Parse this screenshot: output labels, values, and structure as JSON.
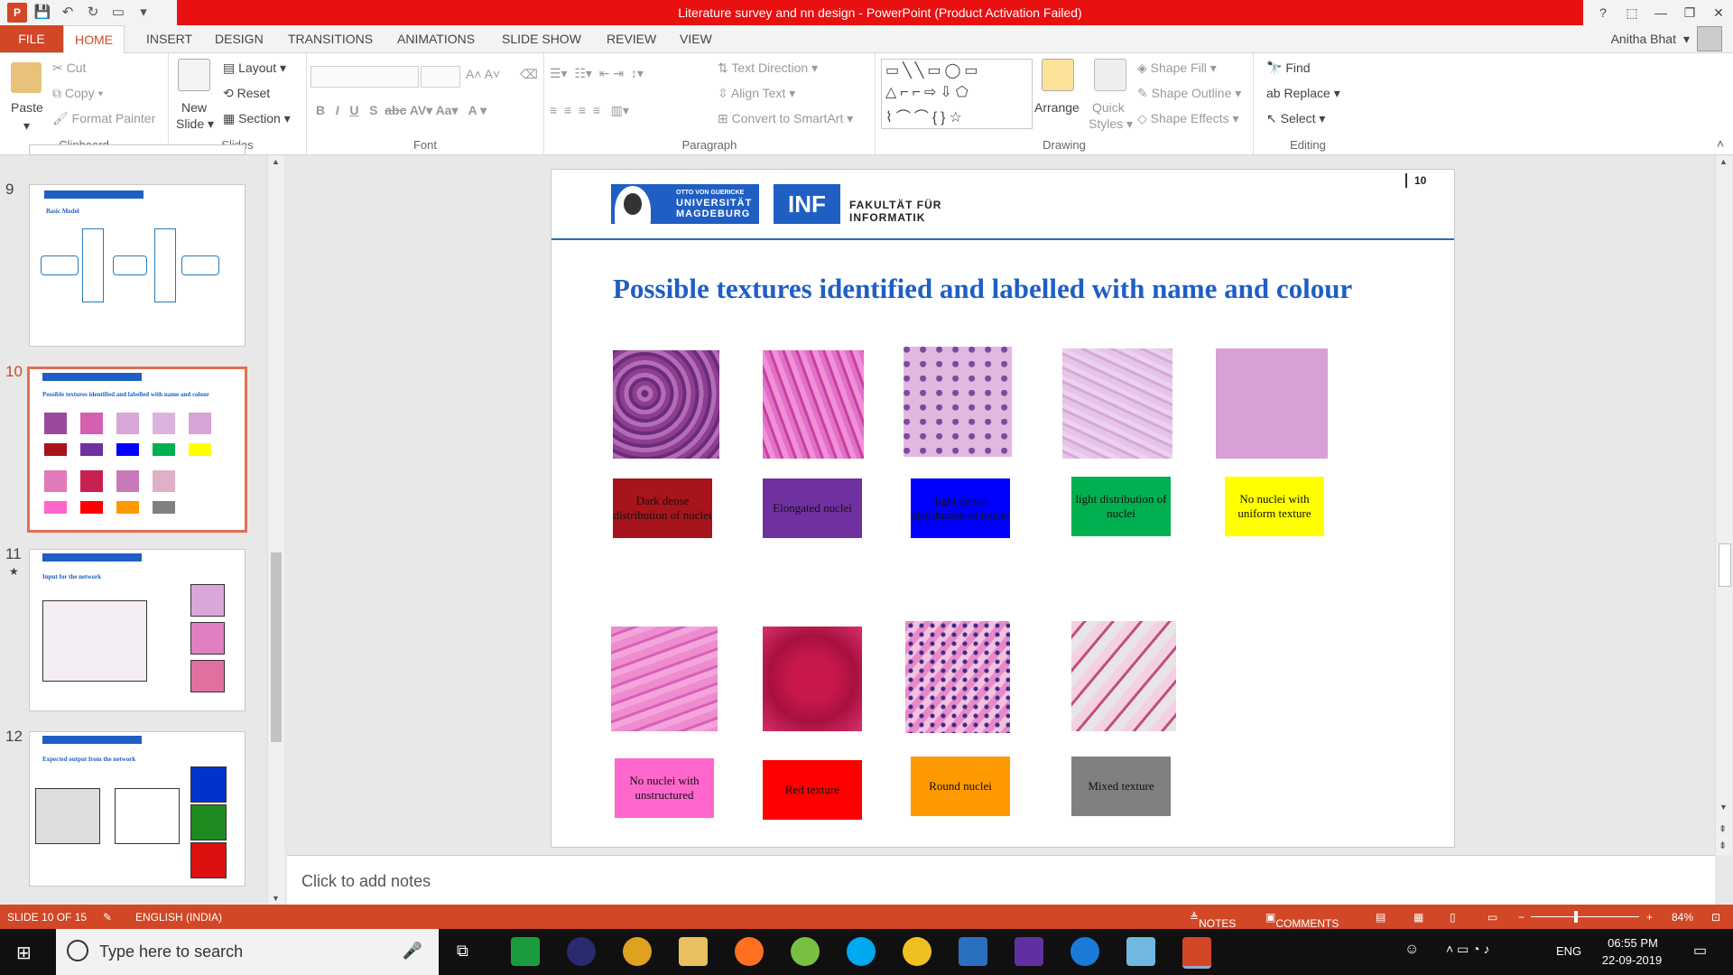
{
  "window": {
    "title": "Literature survey and nn design -  PowerPoint (Product Activation Failed)",
    "user": "Anitha Bhat"
  },
  "tabs": [
    "FILE",
    "HOME",
    "INSERT",
    "DESIGN",
    "TRANSITIONS",
    "ANIMATIONS",
    "SLIDE SHOW",
    "REVIEW",
    "VIEW"
  ],
  "ribbon": {
    "clipboard": {
      "paste": "Paste",
      "cut": "Cut",
      "copy": "Copy",
      "format_painter": "Format Painter",
      "label": "Clipboard"
    },
    "slides": {
      "new_slide_1": "New",
      "new_slide_2": "Slide",
      "layout": "Layout",
      "reset": "Reset",
      "section": "Section",
      "label": "Slides"
    },
    "font": {
      "label": "Font"
    },
    "paragraph": {
      "text_direction": "Text Direction",
      "align_text": "Align Text",
      "convert_smartart": "Convert to SmartArt",
      "label": "Paragraph"
    },
    "drawing": {
      "arrange": "Arrange",
      "quick_1": "Quick",
      "quick_2": "Styles",
      "shape_fill": "Shape Fill",
      "shape_outline": "Shape Outline",
      "shape_effects": "Shape Effects",
      "label": "Drawing"
    },
    "editing": {
      "find": "Find",
      "replace": "Replace",
      "select": "Select",
      "label": "Editing"
    }
  },
  "thumbnails": [
    {
      "num": "9",
      "title": "Basic Model"
    },
    {
      "num": "10",
      "title": "Possible textures identified and labelled with name and colour"
    },
    {
      "num": "11",
      "title": "Input for the network"
    },
    {
      "num": "12",
      "title": "Expected output from the network"
    }
  ],
  "slide": {
    "page_number": "10",
    "univ_small": "OTTO VON GUERICKE",
    "univ_line1": "UNIVERSITÄT",
    "univ_line2": "MAGDEBURG",
    "inf": "INF",
    "faculty_1": "FAKULTÄT FÜR",
    "faculty_2": "INFORMATIK",
    "title": "Possible textures identified and labelled with name and colour",
    "labels_row1": [
      "Dark dense distribution of nuclei",
      "Elongated nuclei",
      "light dense distribution of nuclei",
      "light distribution of nuclei",
      "No nuclei with uniform texture"
    ],
    "labels_row2": [
      "No nuclei with unstructured",
      "Red texture",
      "Round nuclei",
      "Mixed texture"
    ],
    "colors_row1": [
      "#a8141c",
      "#7030a0",
      "#0000ff",
      "#00b050",
      "#ffff00"
    ],
    "colors_row2": [
      "#ff66cc",
      "#ff0000",
      "#ff9900",
      "#808080"
    ]
  },
  "notes": {
    "placeholder": "Click to add notes"
  },
  "status": {
    "slide": "SLIDE 10 OF 15",
    "language": "ENGLISH (INDIA)",
    "notes": "NOTES",
    "comments": "COMMENTS",
    "zoom": "84%"
  },
  "taskbar": {
    "search": "Type here to search",
    "lang": "ENG",
    "time": "06:55 PM",
    "date": "22-09-2019"
  }
}
